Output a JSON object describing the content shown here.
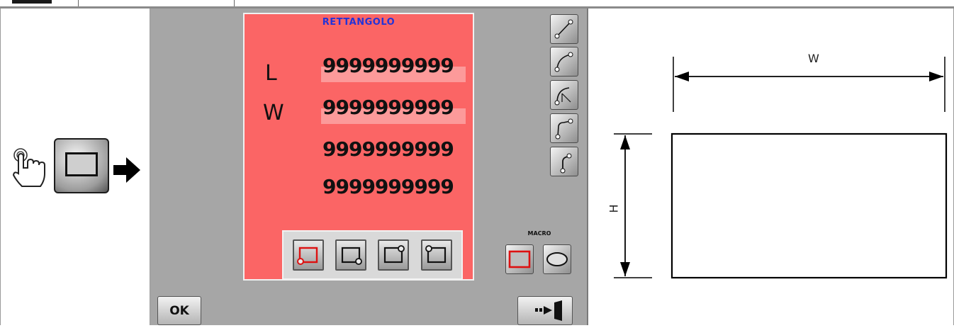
{
  "form": {
    "title": "RETTANGOLO",
    "rows": [
      {
        "label": "L",
        "value": "9999999999"
      },
      {
        "label": "W",
        "value": "9999999999"
      },
      {
        "label": "",
        "value": "9999999999"
      },
      {
        "label": "",
        "value": "9999999999"
      }
    ]
  },
  "mode_buttons": [
    "corner-bottom-left-icon",
    "corner-bottom-right-icon",
    "corner-top-right-icon",
    "corner-top-left-icon"
  ],
  "tools": [
    "line-icon",
    "arc-icon",
    "arc-radius-icon",
    "polyline-icon",
    "hook-icon"
  ],
  "macro": {
    "label": "MACRO",
    "buttons": [
      "rectangle-icon",
      "ellipse-icon"
    ]
  },
  "footer": {
    "ok_label": "OK"
  },
  "diagram": {
    "width_label": "W",
    "height_label": "H"
  },
  "colors": {
    "form_bg": "#fb6565",
    "title": "#2433d8",
    "panel": "#a6a6a6"
  }
}
